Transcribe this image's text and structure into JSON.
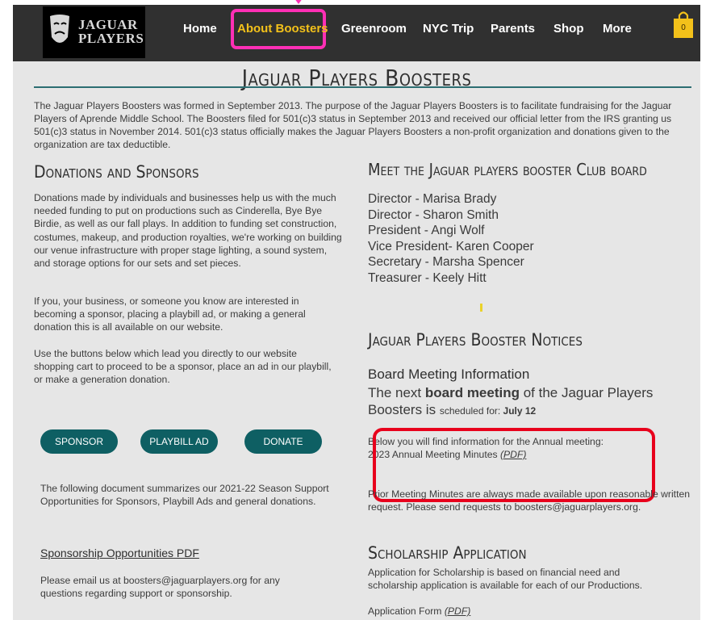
{
  "nav": {
    "logo_line1": "JAGUAR",
    "logo_line2": "PLAYERS",
    "items": [
      "Home",
      "About Boosters",
      "Greenroom",
      "NYC Trip",
      "Parents",
      "Shop",
      "More"
    ],
    "active_index": 1,
    "cart_count": "0"
  },
  "page": {
    "title": "Jaguar Players Boosters",
    "intro": "The Jaguar Players Boosters was formed in September 2013. The purpose of the Jaguar Players Boosters is to facilitate fundraising for the Jaguar Players of Aprende Middle School. The Boosters filed for 501(c)3 status in September 2013 and received our official letter from the IRS granting us 501(c)3 status in November 2014. 501(c)3 status officially makes the Jaguar Players Boosters a non-profit organization and donations given to the organization are tax deductible."
  },
  "donations": {
    "heading": "Donations and Sponsors",
    "p1": "Donations made by individuals and businesses help us with the much needed funding to put on productions such as Cinderella, Bye Bye Birdie, as well as our fall plays. In addition to funding set construction, costumes, makeup, and production royalties, we're working on building our venue infrastructure with proper stage lighting, a sound system, and storage options for our sets and set pieces.",
    "p2": "If you, your business, or someone you know are interested in becoming a sponsor, placing a playbill ad, or making a general donation this is all available on our website.",
    "p3": "Use the buttons below which lead you directly to our website shopping cart to proceed to be a sponsor, place an ad in our playbill, or make a generation donation.",
    "buttons": [
      "SPONSOR",
      "PLAYBILL AD",
      "DONATE"
    ],
    "p4": "The following document summarizes our 2021-22 Season Support Opportunities for Sponsors, Playbill Ads and general donations.",
    "pdf_link": "Sponsorship Opportunities PDF",
    "p5": "Please email us at boosters@jaguarplayers.org for any questions regarding support or sponsorship."
  },
  "board": {
    "heading": "Meet the Jaguar players booster Club board",
    "members": [
      "Director - Marisa Brady",
      "Director - Sharon Smith",
      "President - Angi Wolf",
      "Vice President- Karen Cooper",
      "Secretary - Marsha Spencer",
      "Treasurer - Keely Hitt"
    ]
  },
  "notices": {
    "heading": "Jaguar Players Booster Notices",
    "sub": "Board Meeting Information",
    "line1_pre": "The next ",
    "line1_bold": "board meeting",
    "line1_post": " of the Jaguar Players",
    "line2_pre": "Boosters is ",
    "line2_small": "scheduled for: ",
    "line2_date": "July 12",
    "annual_intro": "Below you will find information for the Annual meeting:",
    "annual_item": "2023 Annual Meeting Minutes ",
    "annual_pdf": "(PDF)",
    "prior": "Prior Meeting Minutes are always made available upon reasonable written request. Please send requests to boosters@jaguarplayers.org."
  },
  "scholarship": {
    "heading": "Scholarship Application",
    "text": "Application for Scholarship is based on financial need and scholarship application is available for each of our Productions.",
    "form_label": "Application Form ",
    "form_pdf": "(PDF)"
  },
  "colors": {
    "nav_bg": "#303030",
    "active_nav": "#f3c11a",
    "button": "#0e5f63",
    "highlight_magenta": "#ff2fb5",
    "highlight_red": "#e8001c"
  }
}
